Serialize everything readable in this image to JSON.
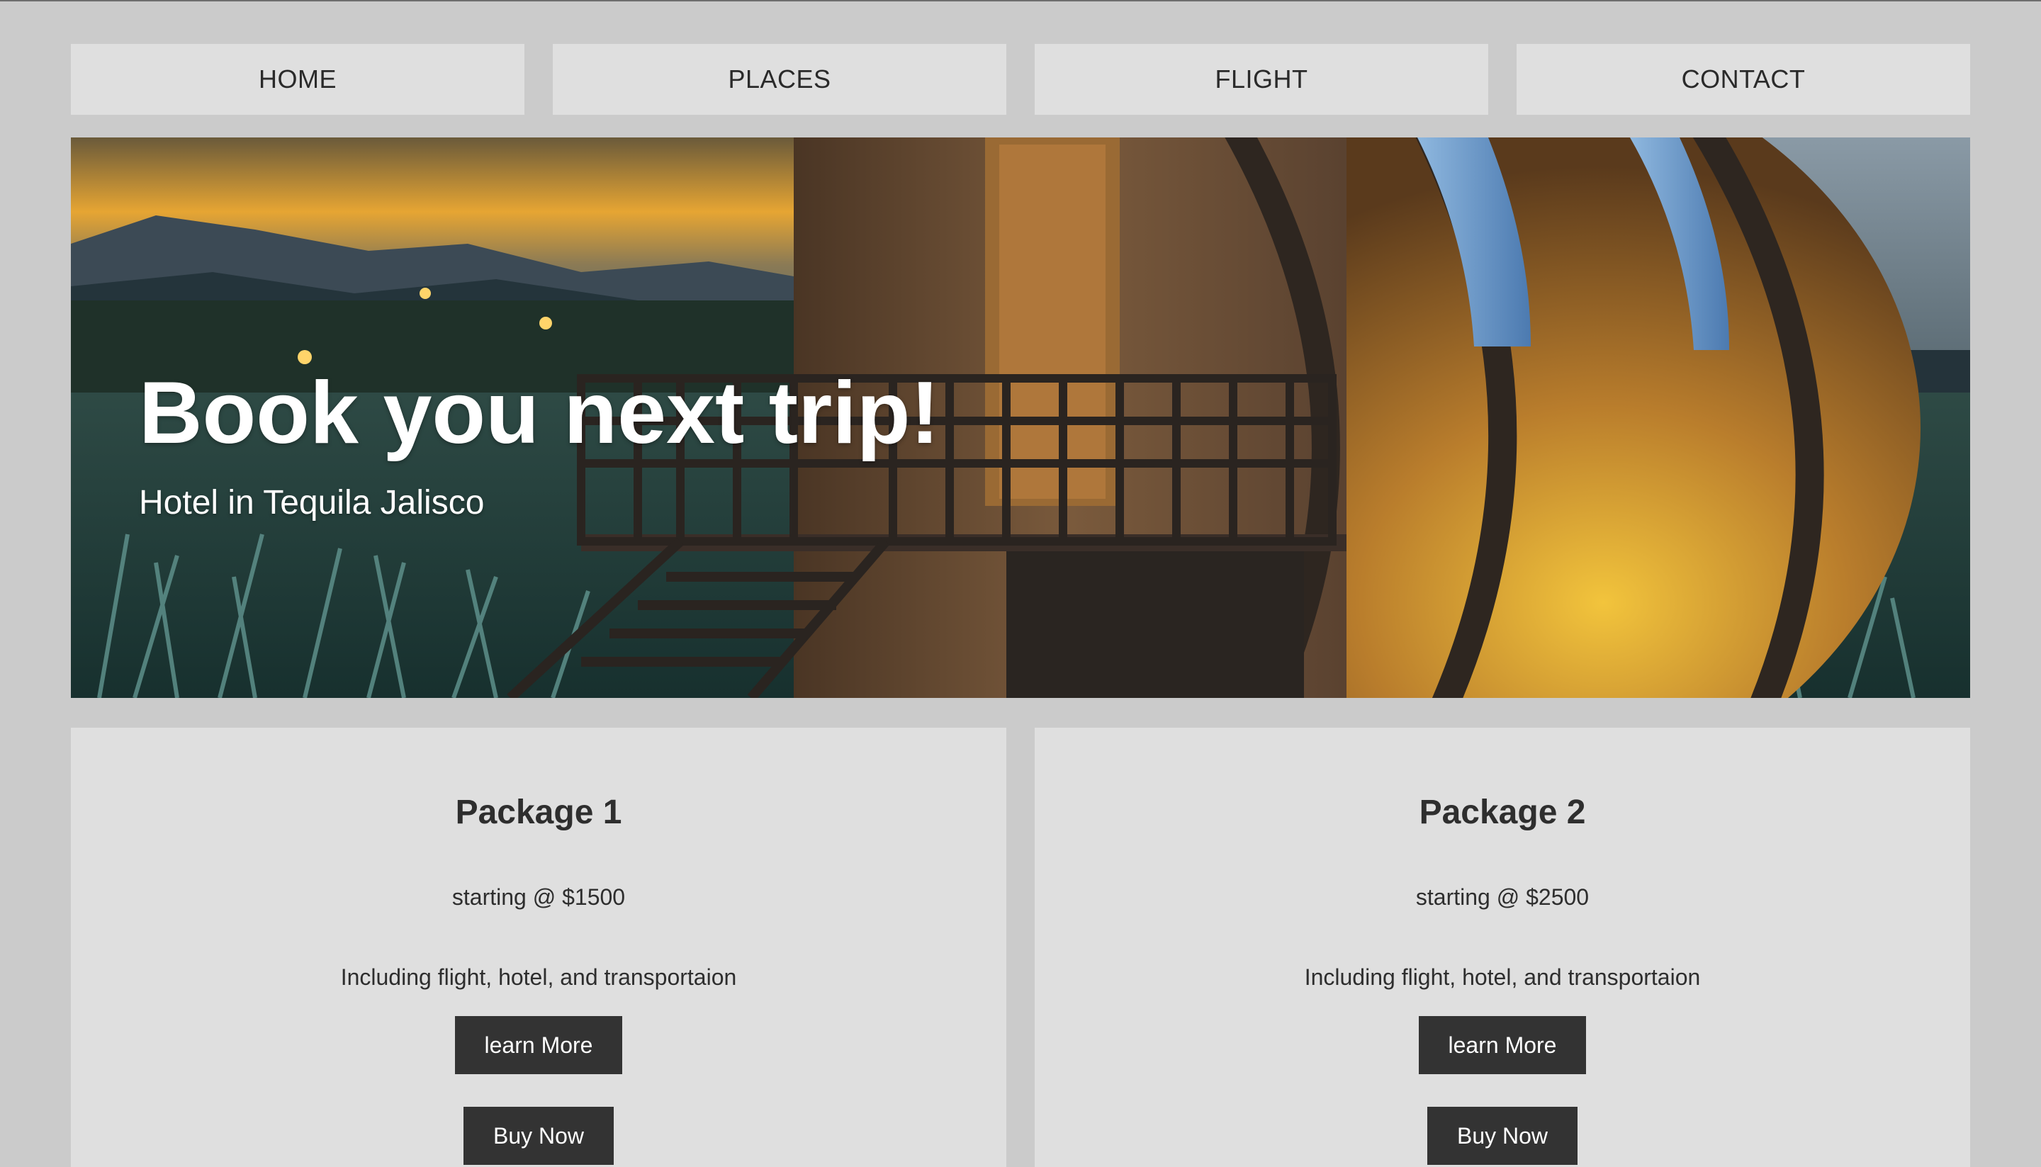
{
  "nav": {
    "items": [
      {
        "label": "HOME"
      },
      {
        "label": "PLACES"
      },
      {
        "label": "FLIGHT"
      },
      {
        "label": "CONTACT"
      }
    ]
  },
  "hero": {
    "title": "Book you next trip!",
    "subtitle": "Hotel in Tequila Jalisco"
  },
  "packages": [
    {
      "title": "Package 1",
      "price": "starting @ $1500",
      "description": "Including flight, hotel, and transportaion",
      "learn_label": "learn More",
      "buy_label": "Buy Now"
    },
    {
      "title": "Package 2",
      "price": "starting @ $2500",
      "description": "Including flight, hotel, and transportaion",
      "learn_label": "learn More",
      "buy_label": "Buy Now"
    }
  ],
  "colors": {
    "page_background": "#cbcbcb",
    "card_background": "#dfdfdf",
    "button_background": "#333333",
    "button_text": "#ffffff"
  }
}
